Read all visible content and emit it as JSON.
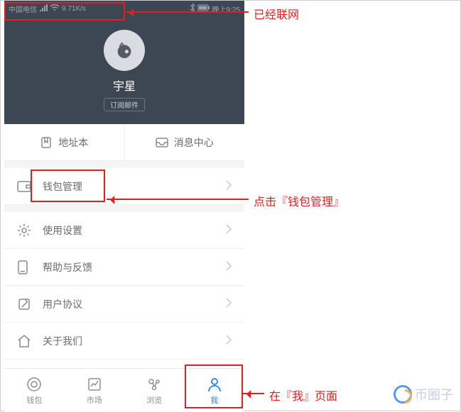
{
  "status": {
    "carrier": "中国电信",
    "speed": "9.71K/s",
    "time": "晚上9:25"
  },
  "profile": {
    "username": "宇星",
    "subscribe": "订阅邮件"
  },
  "twin": {
    "address_book": "地址本",
    "message_center": "消息中心"
  },
  "menu": {
    "wallet_mgmt": "钱包管理",
    "settings": "使用设置",
    "help": "帮助与反馈",
    "agreement": "用户协议",
    "about": "关于我们"
  },
  "nav": {
    "wallet": "钱包",
    "market": "市场",
    "browse": "浏览",
    "me": "我"
  },
  "annotations": {
    "connected": "已经联网",
    "click_wallet": "点击『钱包管理』",
    "on_me_page": "在『我』页面"
  },
  "watermark": "币圈子"
}
